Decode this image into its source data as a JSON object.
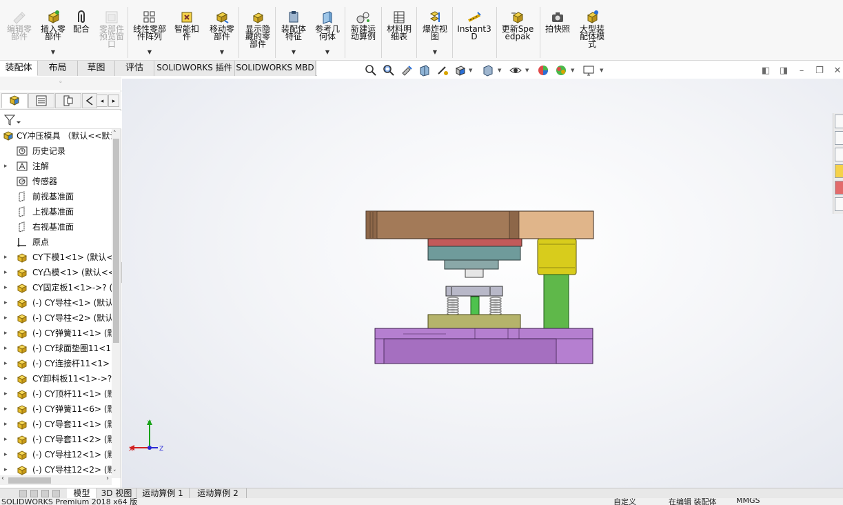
{
  "ribbon": {
    "buttons": [
      {
        "id": "edit-component",
        "label": "编辑零部件",
        "disabled": true
      },
      {
        "id": "insert-component",
        "label": "插入零部件",
        "has_dropdown": true
      },
      {
        "id": "mate",
        "label": "配合"
      },
      {
        "id": "component-preview",
        "label": "零部件预览窗口",
        "disabled": true
      },
      {
        "id": "linear-pattern",
        "label": "线性零部件阵列",
        "has_dropdown": true
      },
      {
        "id": "smart-fasteners",
        "label": "智能扣件"
      },
      {
        "id": "move-component",
        "label": "移动零部件",
        "has_dropdown": true
      },
      {
        "id": "show-hidden",
        "label": "显示隐藏的零部件"
      },
      {
        "id": "assembly-features",
        "label": "装配体特征",
        "has_dropdown": true
      },
      {
        "id": "reference-geometry",
        "label": "参考几何体",
        "has_dropdown": true
      },
      {
        "id": "new-motion-study",
        "label": "新建运动算例"
      },
      {
        "id": "bill-of-materials",
        "label": "材料明细表"
      },
      {
        "id": "exploded-view",
        "label": "爆炸视图",
        "has_dropdown": true
      },
      {
        "id": "instant3d",
        "label": "Instant3D"
      },
      {
        "id": "update-speedpak",
        "label": "更新Speedpak"
      },
      {
        "id": "take-snapshot",
        "label": "拍快照"
      },
      {
        "id": "large-assembly-mode",
        "label": "大型装配体模式"
      }
    ]
  },
  "command_tabs": [
    "装配体",
    "布局",
    "草图",
    "评估",
    "SOLIDWORKS 插件",
    "SOLIDWORKS MBD"
  ],
  "active_command_tab": "装配体",
  "feature_tree": {
    "root": "CY冲压模具 （默认<<默认>",
    "items": [
      {
        "label": "历史记录",
        "icon": "history-icon",
        "expandable": false
      },
      {
        "label": "注解",
        "icon": "annotations-icon",
        "expandable": true
      },
      {
        "label": "传感器",
        "icon": "sensors-icon",
        "expandable": false
      },
      {
        "label": "前视基准面",
        "icon": "plane-icon",
        "expandable": false
      },
      {
        "label": "上视基准面",
        "icon": "plane-icon",
        "expandable": false
      },
      {
        "label": "右视基准面",
        "icon": "plane-icon",
        "expandable": false
      },
      {
        "label": "原点",
        "icon": "origin-icon",
        "expandable": false
      },
      {
        "label": "CY下模1<1> (默认<",
        "icon": "part-icon",
        "expandable": true
      },
      {
        "label": "CY凸模<1> (默认<<",
        "icon": "part-icon",
        "expandable": true
      },
      {
        "label": "CY固定板1<1>->? (",
        "icon": "part-icon",
        "expandable": true
      },
      {
        "label": "(-) CY导柱<1> (默认",
        "icon": "part-icon",
        "expandable": true
      },
      {
        "label": "(-) CY导柱<2> (默认",
        "icon": "part-icon",
        "expandable": true
      },
      {
        "label": "(-) CY弹簧11<1> (默",
        "icon": "part-icon",
        "expandable": true
      },
      {
        "label": "(-) CY球面垫圈11<1",
        "icon": "part-icon",
        "expandable": true
      },
      {
        "label": "(-) CY连接杆11<1> (",
        "icon": "part-icon",
        "expandable": true
      },
      {
        "label": "CY卸料板11<1>->?",
        "icon": "part-icon",
        "expandable": true
      },
      {
        "label": "(-) CY顶杆11<1> (默",
        "icon": "part-icon",
        "expandable": true
      },
      {
        "label": "(-) CY弹簧11<6> (默",
        "icon": "part-icon",
        "expandable": true
      },
      {
        "label": "(-) CY导套11<1> (默",
        "icon": "part-icon",
        "expandable": true
      },
      {
        "label": "(-) CY导套11<2> (默",
        "icon": "part-icon",
        "expandable": true
      },
      {
        "label": "(-) CY导柱12<1> (默",
        "icon": "part-icon",
        "expandable": true
      },
      {
        "label": "(-) CY导柱12<2> (默",
        "icon": "part-icon",
        "expandable": true
      }
    ]
  },
  "triad": {
    "x_label": "X",
    "y_label": "Y",
    "z_label": "Z"
  },
  "bottom_tabs": [
    "模型",
    "3D 视图",
    "运动算例 1",
    "运动算例 2"
  ],
  "active_bottom_tab": "模型",
  "status_bar": {
    "app": "SOLIDWORKS Premium 2018 x64 版",
    "custom": "自定义",
    "editing": "在编辑 装配体",
    "units": "MMGS"
  },
  "colors": {
    "upper_plate": "#a37a58",
    "guide_bush": "#e0b58a",
    "guide_pillar_top": "#d8cc1c",
    "guide_pillar": "#5fb84a",
    "punch_holder": "#c25a5a",
    "stripper": "#6f9b9b",
    "die_block": "#b5b36b",
    "lower_plate": "#b57fd0",
    "spring": "#8d8d8d"
  }
}
